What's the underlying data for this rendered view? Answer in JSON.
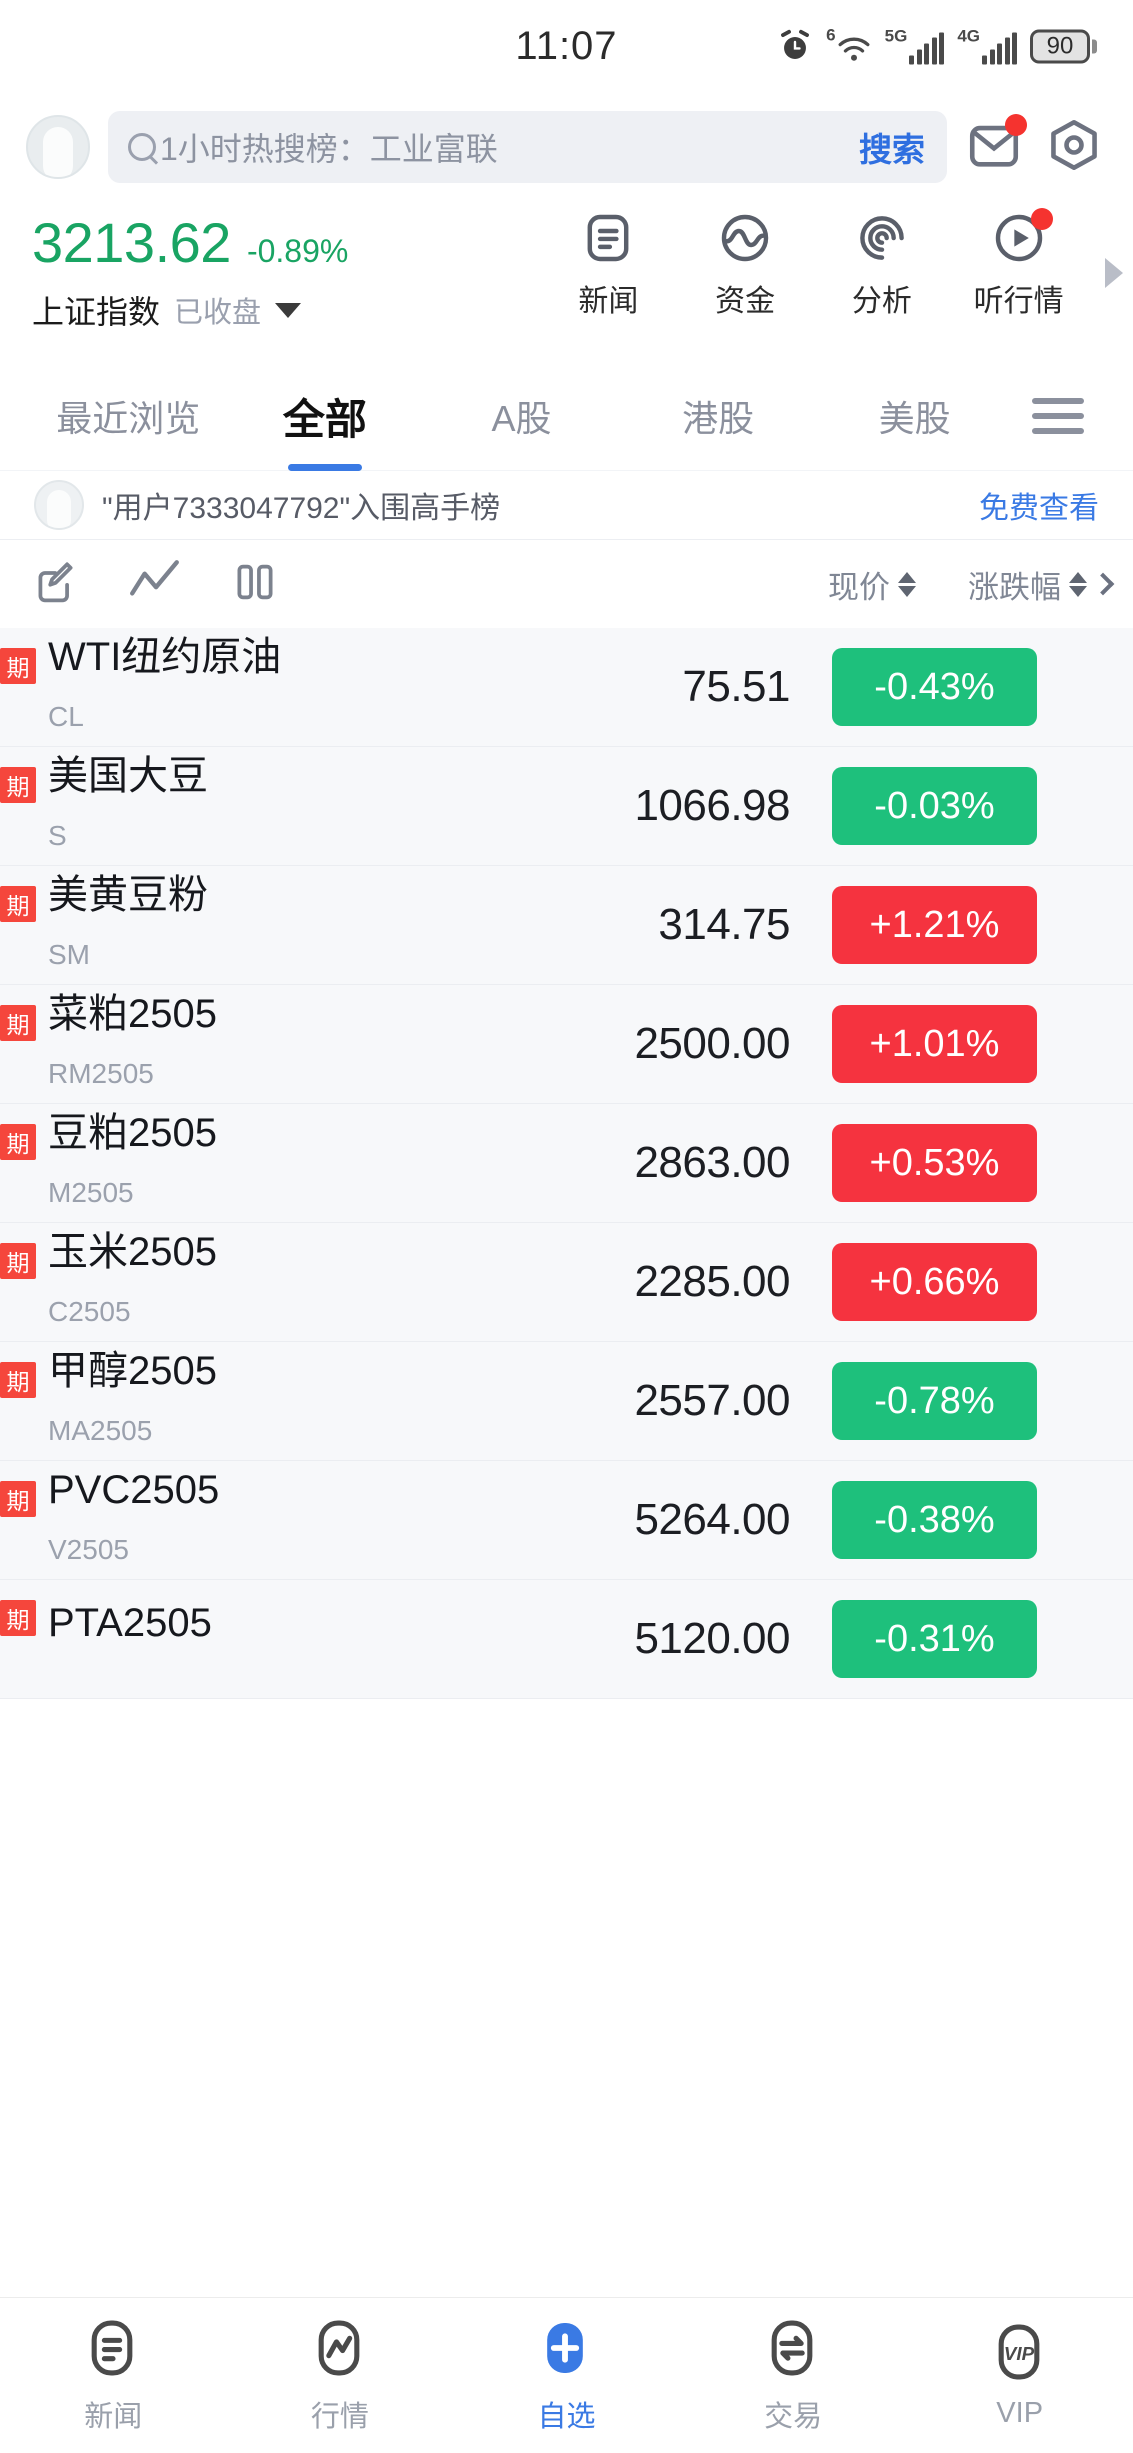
{
  "status_bar": {
    "time": "11:07",
    "alarm_icon": "alarm-icon",
    "wifi_label": "6",
    "net1_label": "5G",
    "net2_label": "4G",
    "battery": "90"
  },
  "search": {
    "placeholder": "1小时热搜榜：工业富联",
    "button_label": "搜索",
    "mail_icon": "mail-icon",
    "scan_icon": "scan-icon",
    "avatar": "avatar-icon"
  },
  "index": {
    "value": "3213.62",
    "change_pct": "-0.89%",
    "name": "上证指数",
    "state": "已收盘",
    "color": "#19a463"
  },
  "quick_actions": [
    {
      "label": "新闻",
      "icon": "news-doc-icon",
      "badge": false
    },
    {
      "label": "资金",
      "icon": "fund-wave-icon",
      "badge": false
    },
    {
      "label": "分析",
      "icon": "analysis-spiral-icon",
      "badge": false
    },
    {
      "label": "听行情",
      "icon": "listen-play-icon",
      "badge": true
    }
  ],
  "tabs": {
    "items": [
      {
        "label": "最近浏览",
        "active": false
      },
      {
        "label": "全部",
        "active": true
      },
      {
        "label": "A股",
        "active": false
      },
      {
        "label": "港股",
        "active": false
      },
      {
        "label": "美股",
        "active": false
      }
    ],
    "menu_icon": "hamburger-menu-icon"
  },
  "promo": {
    "text": "\"用户7333047792\"入围高手榜",
    "link_label": "免费查看"
  },
  "list_toolbar": {
    "edit_icon": "edit-pencil-icon",
    "chart_icon": "line-chart-icon",
    "columns_icon": "columns-icon",
    "col_price": "现价",
    "col_change": "涨跌幅",
    "chevron_icon": "chevron-right-icon"
  },
  "colors": {
    "up": "#f5333f",
    "down": "#1ec07c",
    "accent": "#3a7ae4",
    "tag": "#f5463c"
  },
  "stocks": [
    {
      "tag": "期",
      "name": "WTI纽约原油",
      "code": "CL",
      "price": "75.51",
      "pct": "-0.43%",
      "dir": "down"
    },
    {
      "tag": "期",
      "name": "美国大豆",
      "code": "S",
      "price": "1066.98",
      "pct": "-0.03%",
      "dir": "down"
    },
    {
      "tag": "期",
      "name": "美黄豆粉",
      "code": "SM",
      "price": "314.75",
      "pct": "+1.21%",
      "dir": "up"
    },
    {
      "tag": "期",
      "name": "菜粕2505",
      "code": "RM2505",
      "price": "2500.00",
      "pct": "+1.01%",
      "dir": "up"
    },
    {
      "tag": "期",
      "name": "豆粕2505",
      "code": "M2505",
      "price": "2863.00",
      "pct": "+0.53%",
      "dir": "up"
    },
    {
      "tag": "期",
      "name": "玉米2505",
      "code": "C2505",
      "price": "2285.00",
      "pct": "+0.66%",
      "dir": "up"
    },
    {
      "tag": "期",
      "name": "甲醇2505",
      "code": "MA2505",
      "price": "2557.00",
      "pct": "-0.78%",
      "dir": "down"
    },
    {
      "tag": "期",
      "name": "PVC2505",
      "code": "V2505",
      "price": "5264.00",
      "pct": "-0.38%",
      "dir": "down"
    },
    {
      "tag": "期",
      "name": "PTA2505",
      "code": "",
      "price": "5120.00",
      "pct": "-0.31%",
      "dir": "down"
    }
  ],
  "bottom_nav": [
    {
      "label": "新闻",
      "icon": "news-icon",
      "active": false
    },
    {
      "label": "行情",
      "icon": "quotes-icon",
      "active": false
    },
    {
      "label": "自选",
      "icon": "plus-icon",
      "active": true
    },
    {
      "label": "交易",
      "icon": "trade-icon",
      "active": false
    },
    {
      "label": "VIP",
      "icon": "vip-icon",
      "active": false
    }
  ]
}
